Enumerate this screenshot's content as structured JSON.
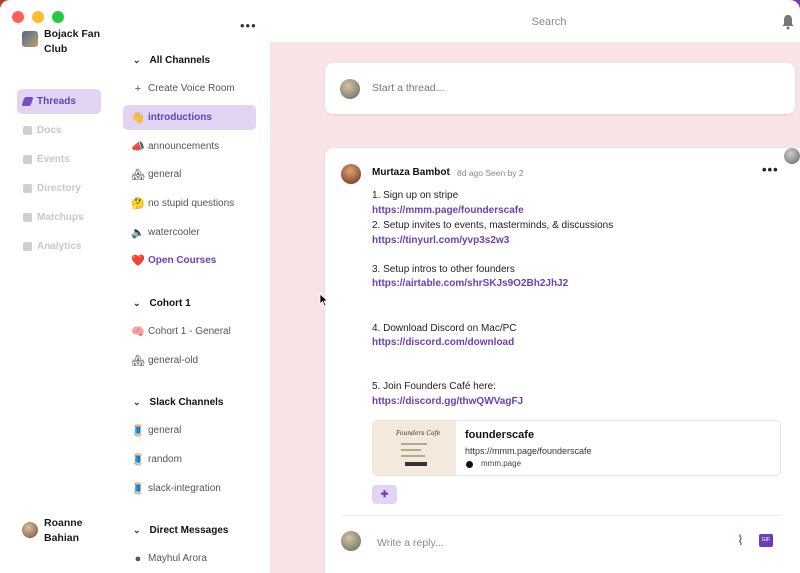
{
  "titlebar": {
    "search_placeholder": "Search"
  },
  "server": {
    "name": "Bojack Fan Club"
  },
  "rail": {
    "items": [
      {
        "label": "Threads",
        "icon": "quill-icon",
        "active": true
      },
      {
        "label": "Docs",
        "icon": "doc-icon"
      },
      {
        "label": "Events",
        "icon": "calendar-icon"
      },
      {
        "label": "Directory",
        "icon": "directory-icon"
      },
      {
        "label": "Matchups",
        "icon": "matchups-icon"
      },
      {
        "label": "Analytics",
        "icon": "analytics-icon"
      }
    ]
  },
  "user": {
    "name": "Roanne Bahian"
  },
  "channels": {
    "sections": {
      "all": "All Channels",
      "cohort": "Cohort 1",
      "slack": "Slack Channels",
      "dm": "Direct Messages"
    },
    "create_voice_room": "Create Voice Room",
    "all": [
      {
        "emoji": "👋",
        "label": "introductions",
        "active": true
      },
      {
        "emoji": "📣",
        "label": "announcements"
      },
      {
        "emoji": "🏘",
        "label": "general"
      },
      {
        "emoji": "🤔",
        "label": "no stupid questions"
      },
      {
        "emoji": "🔈",
        "label": "watercooler"
      },
      {
        "emoji": "❤️",
        "label": "Open Courses",
        "highlight": true
      }
    ],
    "cohort": [
      {
        "emoji": "🧠",
        "label": "Cohort 1 - General"
      },
      {
        "emoji": "🏘",
        "label": "general-old"
      }
    ],
    "slack": [
      {
        "emoji": "🧵",
        "label": "general"
      },
      {
        "emoji": "🧵",
        "label": "random"
      },
      {
        "emoji": "🧵",
        "label": "slack-integration"
      }
    ],
    "dm": [
      {
        "label": "Mayhul Arora"
      }
    ]
  },
  "composer": {
    "placeholder": "Start a thread..."
  },
  "post": {
    "author": "Murtaza Bambot",
    "meta": "8d ago   Seen by 2",
    "lines": {
      "l1": "1. Sign up on stripe",
      "link1": "https://mmm.page/founderscafe",
      "l2": "2. Setup invites to events, masterminds, & discussions",
      "link2": "https://tinyurl.com/yvp3s2w3",
      "l3": "3. Setup intros to other founders",
      "link3": "https://airtable.com/shrSKJs9O2Bh2JhJ2",
      "l4": "4. Download Discord on Mac/PC",
      "link4": "https://discord.com/download",
      "l5": "5. Join Founders Café here:",
      "link5": "https://discord.gg/thwQWVagFJ"
    },
    "preview": {
      "thumb_title": "Founders Cafe",
      "title": "founderscafe",
      "url": "https://mmm.page/founderscafe",
      "site": "mmm.page"
    },
    "reply_placeholder": "Write a reply...",
    "gif_label": "GIF"
  },
  "colors": {
    "accent": "#6a3fb4",
    "active_bg": "#e2d4f3",
    "main_bg": "#f8e4e4"
  }
}
